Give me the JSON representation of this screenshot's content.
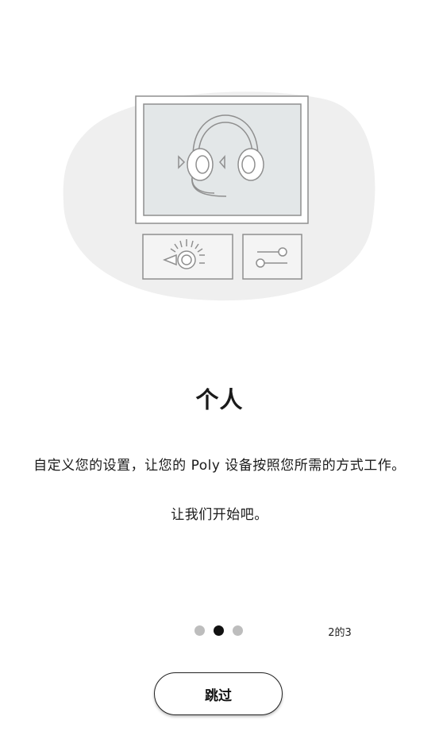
{
  "onboarding": {
    "title": "个人",
    "description": "自定义您的设置，让您的 Poly 设备按照您所需的方式工作。",
    "cta": "让我们开始吧。",
    "page_count": "2的3",
    "pager": {
      "current_page": 2,
      "total_pages": 3
    },
    "skip_label": "跳过"
  },
  "icons": {
    "illustration": "headset-settings-illustration",
    "brightness": "brightness-icon",
    "sliders": "sliders-icon"
  }
}
